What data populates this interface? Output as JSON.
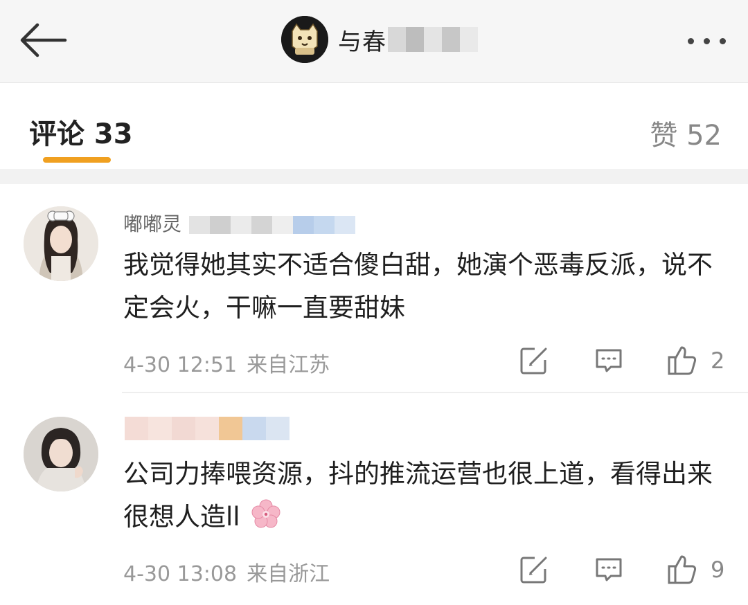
{
  "header": {
    "account_name": "与春",
    "icons": {
      "back": "back-arrow-icon",
      "more": "more-dots-icon"
    }
  },
  "tabs": {
    "comments_label": "评论 33",
    "likes_label": "赞 52",
    "accent_color": "#f0a020"
  },
  "comments": [
    {
      "username": "嘟嘟灵",
      "text": "我觉得她其实不适合傻白甜，她演个恶毒反派，说不定会火，干嘛一直要甜妹",
      "time": "4-30 12:51",
      "location": "来自江苏",
      "likes": "2"
    },
    {
      "username": "",
      "text": "公司力捧喂资源，抖的推流运营也很上道，看得出来很想人造ll",
      "time": "4-30 13:08",
      "location": "来自浙江",
      "likes": "9"
    }
  ]
}
